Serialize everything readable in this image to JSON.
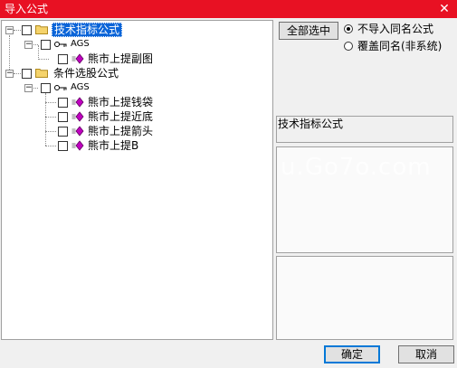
{
  "window": {
    "title": "导入公式",
    "close_glyph": "✕"
  },
  "tree": {
    "nodes": [
      {
        "label": "技术指标公式",
        "selected": true
      },
      {
        "label": "AGS"
      },
      {
        "label": "熊市上提副图"
      },
      {
        "label": "条件选股公式"
      },
      {
        "label": "AGS"
      },
      {
        "label": "熊市上提钱袋"
      },
      {
        "label": "熊市上提近底"
      },
      {
        "label": "熊市上提箭头"
      },
      {
        "label": "熊市上提B"
      }
    ]
  },
  "actions": {
    "select_all": "全部选中",
    "ok": "确定",
    "cancel": "取消"
  },
  "options": {
    "no_import_same": "不导入同名公式",
    "overwrite_same": "覆盖同名(非系统)",
    "selected": "no_import_same"
  },
  "detail": {
    "title": "技术指标公式"
  },
  "watermark": "u.Go7o.com",
  "colors": {
    "titlebar": "#e81123",
    "selection": "#0a64d8",
    "folder": "#f5d36b",
    "formula_icon": "#c000c0"
  }
}
